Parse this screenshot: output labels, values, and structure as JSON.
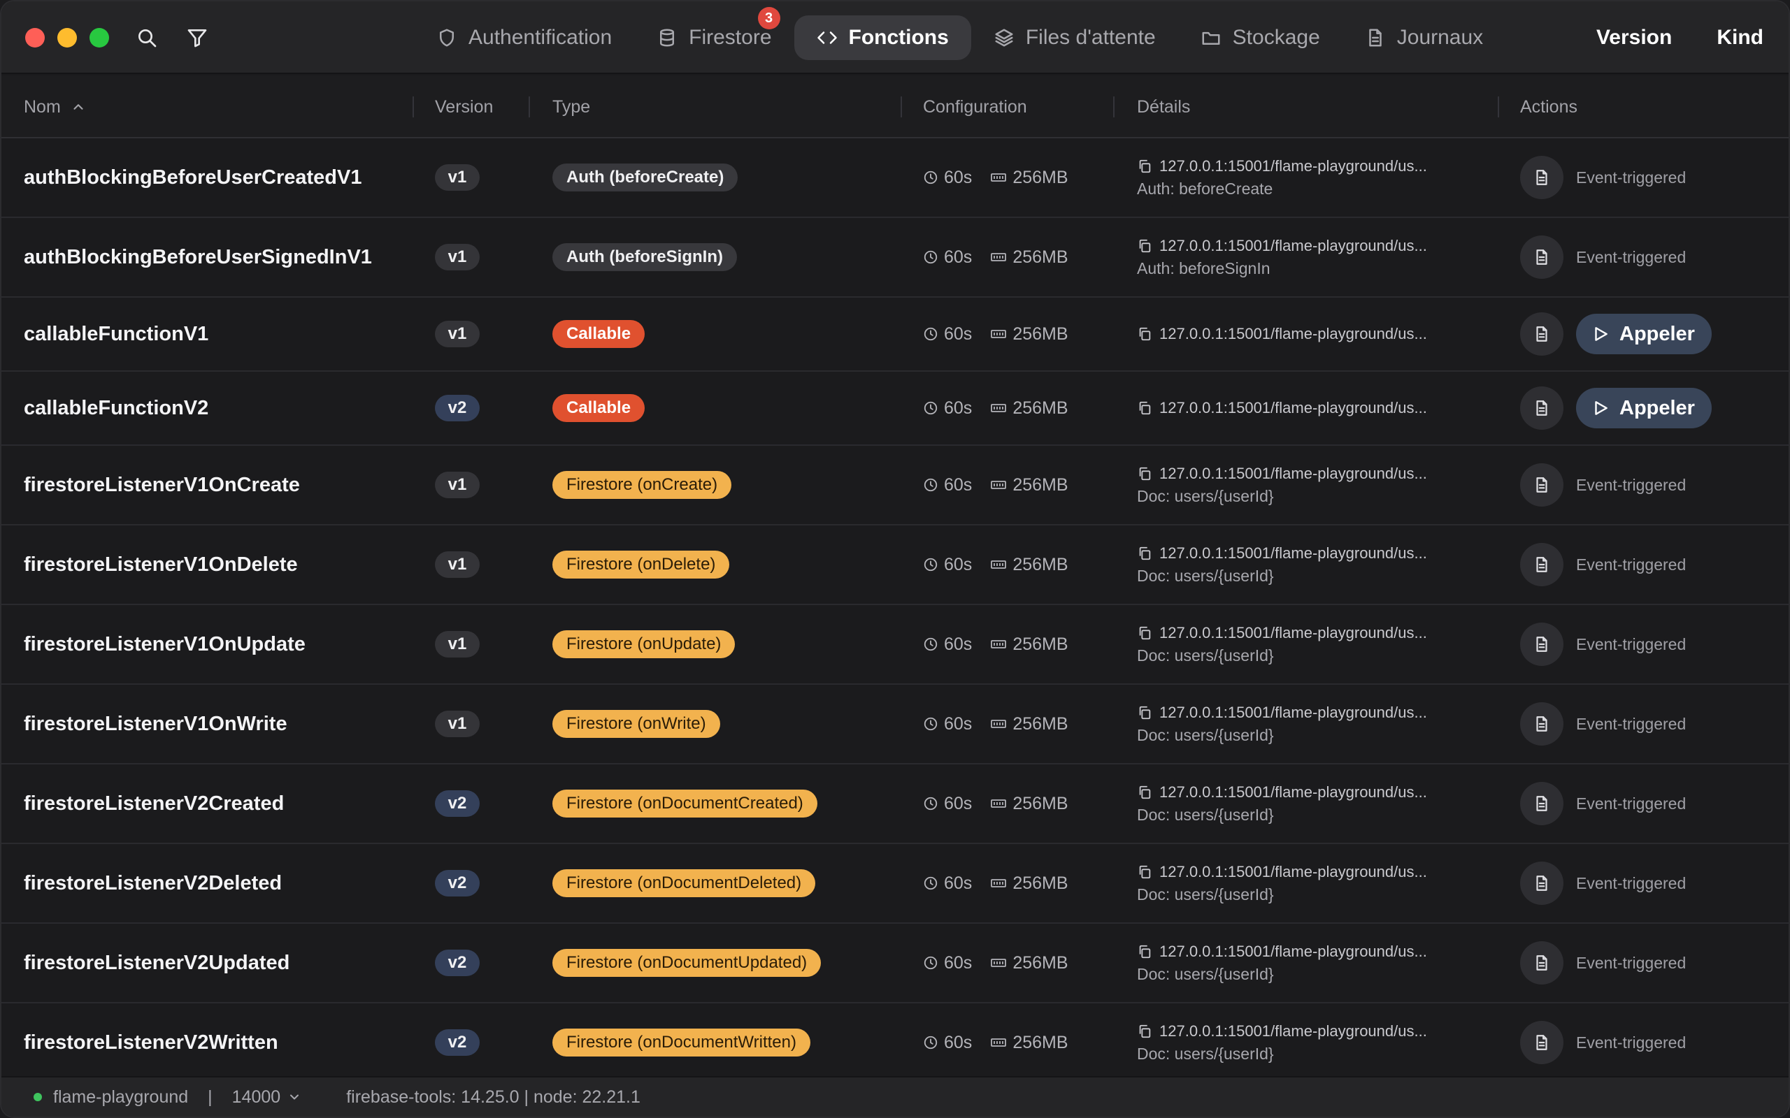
{
  "toolbar": {
    "icons": [
      "search-icon",
      "filter-icon"
    ],
    "right_items": [
      "Version",
      "Kind"
    ]
  },
  "tabs": [
    {
      "label": "Authentification",
      "icon": "shield-icon",
      "active": false
    },
    {
      "label": "Firestore",
      "icon": "database-icon",
      "active": false,
      "badge": "3"
    },
    {
      "label": "Fonctions",
      "icon": "code-icon",
      "active": true
    },
    {
      "label": "Files d'attente",
      "icon": "layers-icon",
      "active": false
    },
    {
      "label": "Stockage",
      "icon": "folder-icon",
      "active": false
    },
    {
      "label": "Journaux",
      "icon": "document-icon",
      "active": false
    }
  ],
  "table": {
    "headers": {
      "name": "Nom",
      "version": "Version",
      "type": "Type",
      "config": "Configuration",
      "details": "Détails",
      "actions": "Actions"
    },
    "sort": {
      "column": "name",
      "direction": "ascending",
      "icon": "chevron-up-icon"
    },
    "rows": [
      {
        "name": "authBlockingBeforeUserCreatedV1",
        "version": "v1",
        "type": "Auth (beforeCreate)",
        "type_kind": "auth",
        "timeout": "60s",
        "memory": "256MB",
        "url": "127.0.0.1:15001/flame-playground/us...",
        "detail": "Auth: beforeCreate",
        "action": "Event-triggered"
      },
      {
        "name": "authBlockingBeforeUserSignedInV1",
        "version": "v1",
        "type": "Auth (beforeSignIn)",
        "type_kind": "auth",
        "timeout": "60s",
        "memory": "256MB",
        "url": "127.0.0.1:15001/flame-playground/us...",
        "detail": "Auth: beforeSignIn",
        "action": "Event-triggered"
      },
      {
        "name": "callableFunctionV1",
        "version": "v1",
        "type": "Callable",
        "type_kind": "callable",
        "timeout": "60s",
        "memory": "256MB",
        "url": "127.0.0.1:15001/flame-playground/us...",
        "detail": "",
        "action": "Appeler"
      },
      {
        "name": "callableFunctionV2",
        "version": "v2",
        "type": "Callable",
        "type_kind": "callable",
        "timeout": "60s",
        "memory": "256MB",
        "url": "127.0.0.1:15001/flame-playground/us...",
        "detail": "",
        "action": "Appeler"
      },
      {
        "name": "firestoreListenerV1OnCreate",
        "version": "v1",
        "type": "Firestore (onCreate)",
        "type_kind": "firestore",
        "timeout": "60s",
        "memory": "256MB",
        "url": "127.0.0.1:15001/flame-playground/us...",
        "detail": "Doc: users/{userId}",
        "action": "Event-triggered"
      },
      {
        "name": "firestoreListenerV1OnDelete",
        "version": "v1",
        "type": "Firestore (onDelete)",
        "type_kind": "firestore",
        "timeout": "60s",
        "memory": "256MB",
        "url": "127.0.0.1:15001/flame-playground/us...",
        "detail": "Doc: users/{userId}",
        "action": "Event-triggered"
      },
      {
        "name": "firestoreListenerV1OnUpdate",
        "version": "v1",
        "type": "Firestore (onUpdate)",
        "type_kind": "firestore",
        "timeout": "60s",
        "memory": "256MB",
        "url": "127.0.0.1:15001/flame-playground/us...",
        "detail": "Doc: users/{userId}",
        "action": "Event-triggered"
      },
      {
        "name": "firestoreListenerV1OnWrite",
        "version": "v1",
        "type": "Firestore (onWrite)",
        "type_kind": "firestore",
        "timeout": "60s",
        "memory": "256MB",
        "url": "127.0.0.1:15001/flame-playground/us...",
        "detail": "Doc: users/{userId}",
        "action": "Event-triggered"
      },
      {
        "name": "firestoreListenerV2Created",
        "version": "v2",
        "type": "Firestore (onDocumentCreated)",
        "type_kind": "firestore",
        "timeout": "60s",
        "memory": "256MB",
        "url": "127.0.0.1:15001/flame-playground/us...",
        "detail": "Doc: users/{userId}",
        "action": "Event-triggered"
      },
      {
        "name": "firestoreListenerV2Deleted",
        "version": "v2",
        "type": "Firestore (onDocumentDeleted)",
        "type_kind": "firestore",
        "timeout": "60s",
        "memory": "256MB",
        "url": "127.0.0.1:15001/flame-playground/us...",
        "detail": "Doc: users/{userId}",
        "action": "Event-triggered"
      },
      {
        "name": "firestoreListenerV2Updated",
        "version": "v2",
        "type": "Firestore (onDocumentUpdated)",
        "type_kind": "firestore",
        "timeout": "60s",
        "memory": "256MB",
        "url": "127.0.0.1:15001/flame-playground/us...",
        "detail": "Doc: users/{userId}",
        "action": "Event-triggered"
      },
      {
        "name": "firestoreListenerV2Written",
        "version": "v2",
        "type": "Firestore (onDocumentWritten)",
        "type_kind": "firestore",
        "timeout": "60s",
        "memory": "256MB",
        "url": "127.0.0.1:15001/flame-playground/us...",
        "detail": "Doc: users/{userId}",
        "action": "Event-triggered"
      }
    ]
  },
  "statusbar": {
    "project": "flame-playground",
    "separator": "|",
    "port": "14000",
    "tools": "firebase-tools: 14.25.0 | node: 22.21.1",
    "status_color": "#3fc45e"
  },
  "colors": {
    "callable": "#e0512f",
    "firestore": "#f2b24e",
    "active_tab": "#3a3a3e",
    "call_button": "#394559",
    "badge": "#e0483e"
  }
}
